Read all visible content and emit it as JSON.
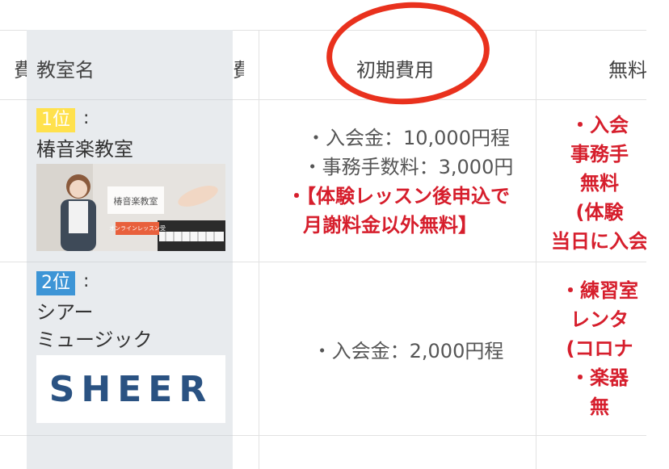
{
  "header": {
    "classroom_col": "教室名",
    "partial_left_glyph": "費",
    "partial_prev_glyph": "費",
    "initial_cost": "初期費用",
    "free_col_partial": "無料"
  },
  "rows": [
    {
      "rank": "1位",
      "colon": ":",
      "name_lines": [
        "椿音楽教室"
      ],
      "photo_label": "椿音楽教室",
      "photo_banner": "オンラインレッスン受付中!!",
      "initial_cost_lines": [
        {
          "text": "・入会金：10,000円程",
          "style": "normal"
        },
        {
          "text": "・事務手数料：3,000円",
          "style": "normal"
        },
        {
          "text": "・【体験レッスン後申込で",
          "style": "red"
        },
        {
          "text": "月謝料金以外無料】",
          "style": "red"
        }
      ],
      "free_lines": [
        "・入会",
        "事務手",
        "無料",
        "(体験",
        "当日に入会"
      ]
    },
    {
      "rank": "2位",
      "colon": ":",
      "name_lines": [
        "シアー",
        "ミュージック"
      ],
      "logo_text": "SHEER",
      "initial_cost_lines": [
        {
          "text": "・入会金：2,000円程",
          "style": "normal"
        }
      ],
      "free_lines": [
        "・練習室",
        "レンタ",
        "(コロナ",
        "・楽器",
        "無"
      ]
    }
  ],
  "colors": {
    "frozen_bg": "#e8ebee",
    "rank1": "#ffe14d",
    "rank2": "#3d95d6",
    "accent_red": "#d61e2c",
    "annotation_circle": "#e9311d",
    "logo_blue": "#2a5282"
  }
}
